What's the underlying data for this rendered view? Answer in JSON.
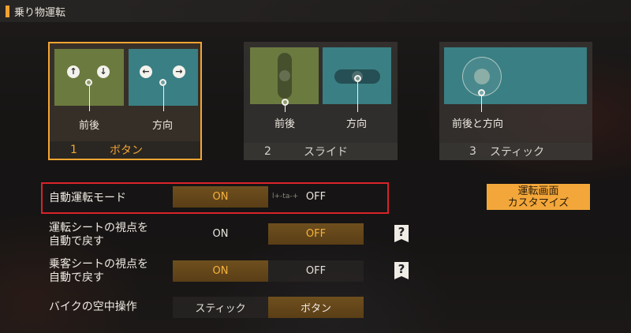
{
  "header": {
    "title": "乗り物運転"
  },
  "modes": [
    {
      "number": "1",
      "label": "ボタン",
      "captions": [
        "前後",
        "方向"
      ],
      "selected": true
    },
    {
      "number": "2",
      "label": "スライド",
      "captions": [
        "前後",
        "方向"
      ],
      "selected": false
    },
    {
      "number": "3",
      "label": "スティック",
      "captions": [
        "前後と方向"
      ],
      "selected": false
    }
  ],
  "settings": {
    "auto_drive": {
      "label": "自動運転モード",
      "on": "ON",
      "off": "OFF",
      "value": "ON",
      "separator": "l+-ta-+"
    },
    "driver_view": {
      "label_line1": "運転シートの視点を",
      "label_line2": "自動で戻す",
      "on": "ON",
      "off": "OFF",
      "value": "OFF"
    },
    "passenger_view": {
      "label_line1": "乗客シートの視点を",
      "label_line2": "自動で戻す",
      "on": "ON",
      "off": "OFF",
      "value": "ON"
    },
    "bike_air": {
      "label": "バイクの空中操作",
      "option_stick": "スティック",
      "option_button": "ボタン",
      "value": "ボタン"
    }
  },
  "help_symbol": "?",
  "custom_button": {
    "line1": "運転画面",
    "line2": "カスタマイズ"
  },
  "colors": {
    "accent": "#f5a532",
    "highlight": "#d8232a",
    "tile_green": "#6b7a3f",
    "tile_teal": "#3a7f84"
  }
}
